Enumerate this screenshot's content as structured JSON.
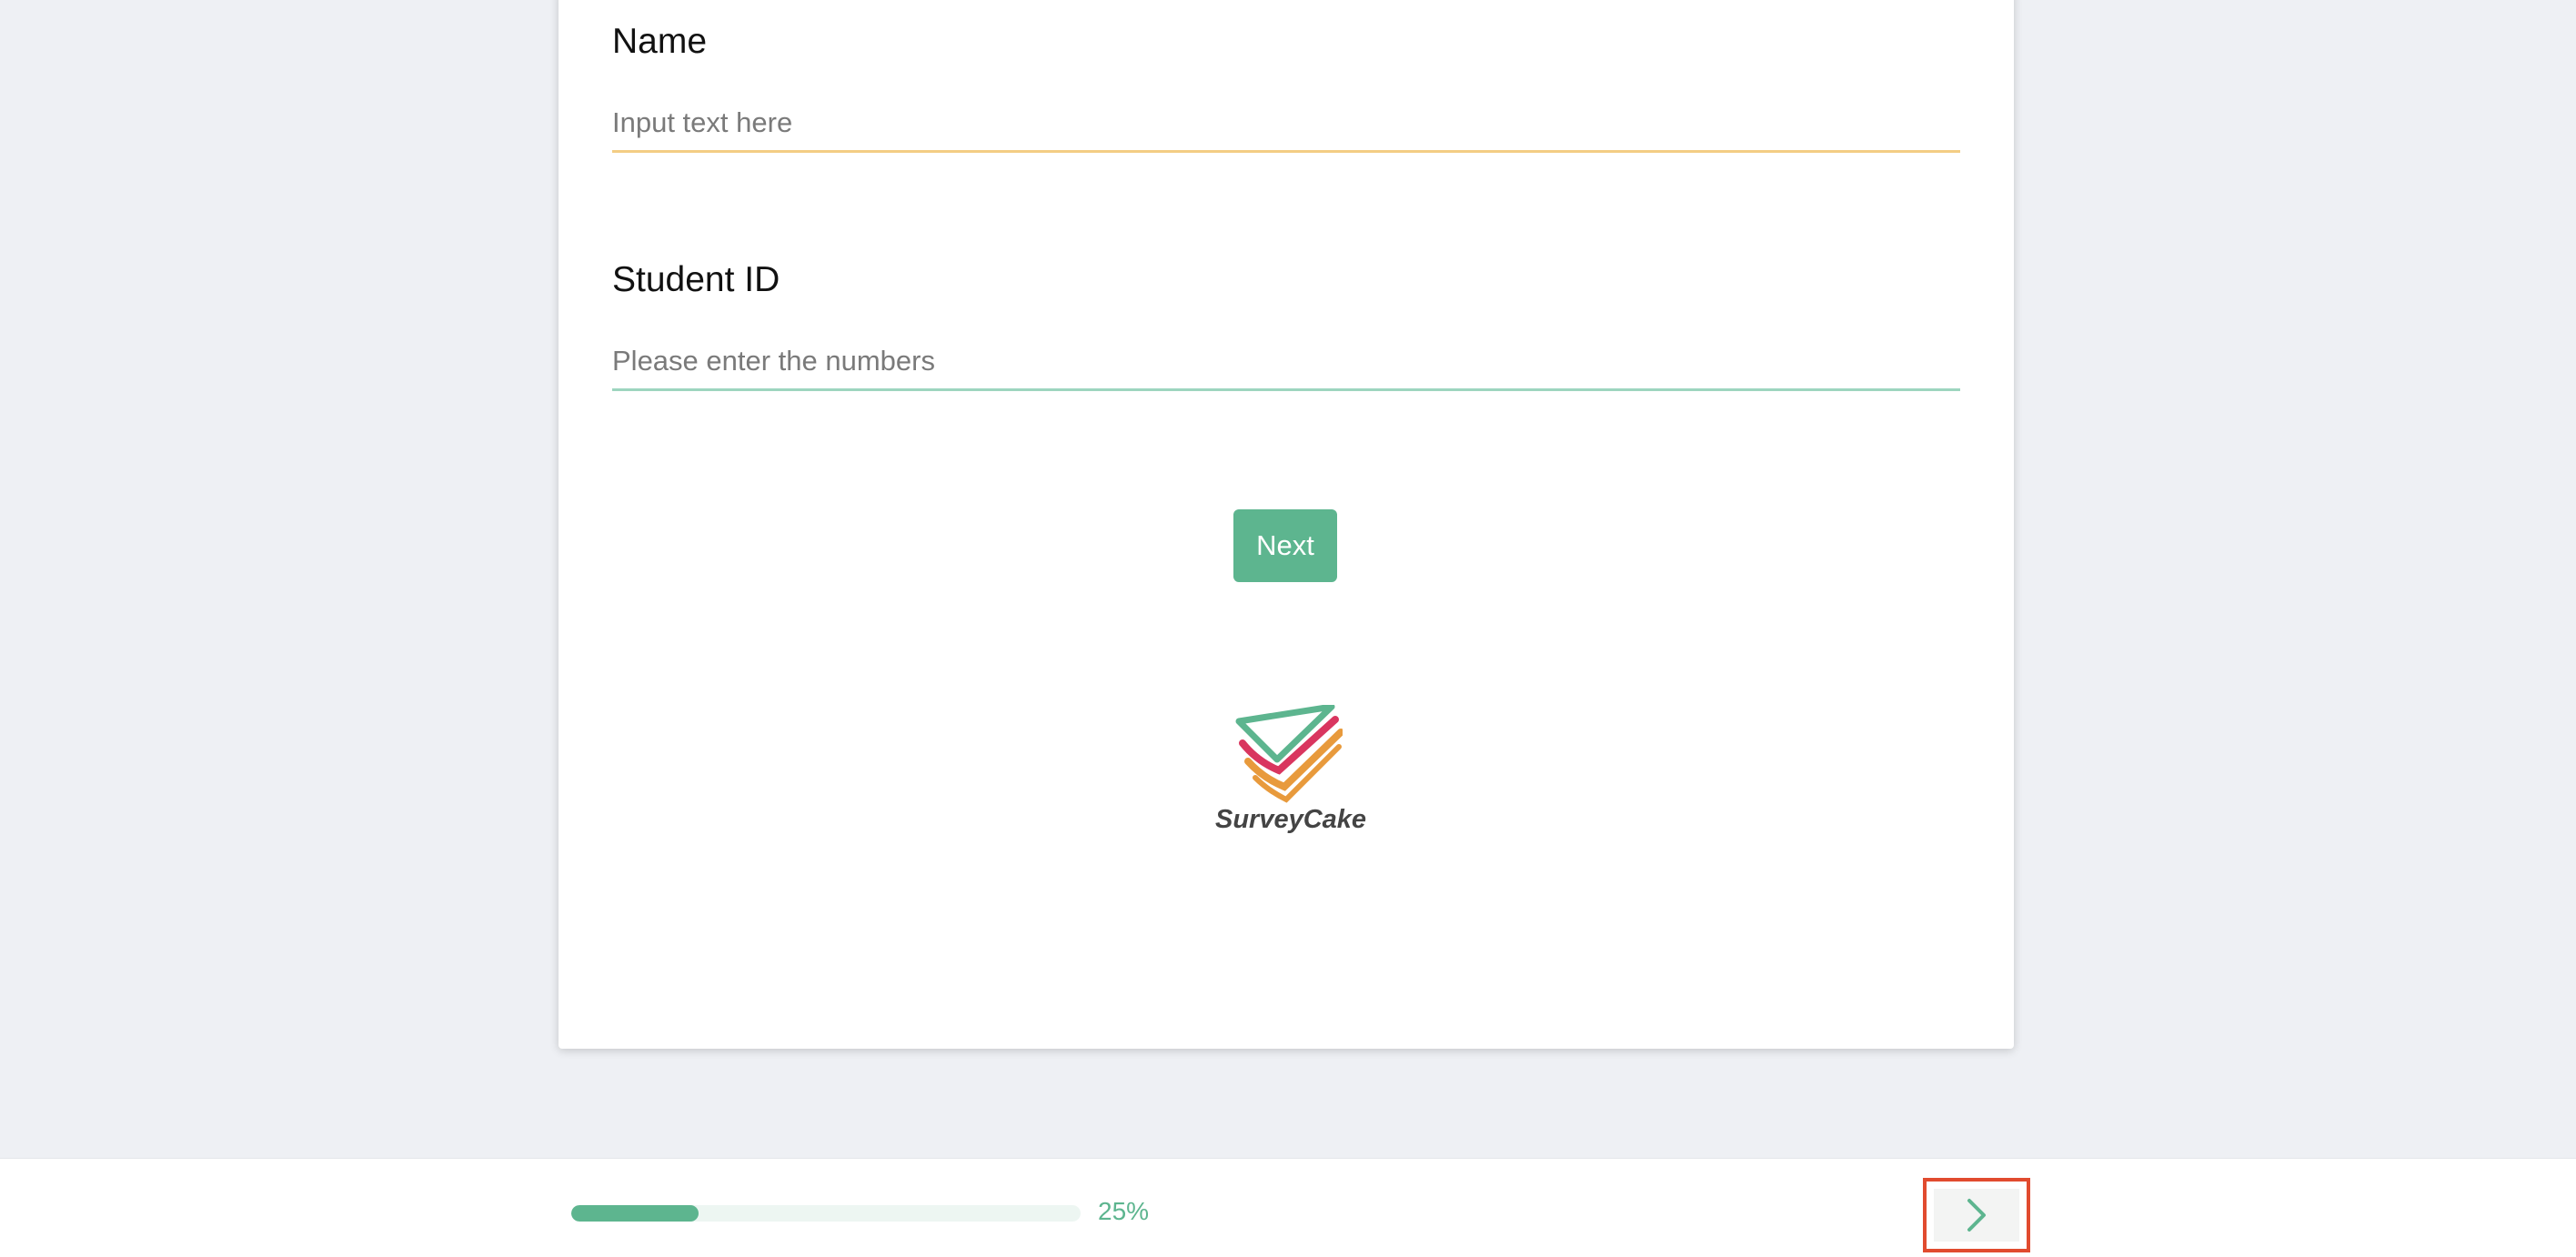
{
  "questions": {
    "name": {
      "title": "Name",
      "placeholder": "Input text here",
      "value": ""
    },
    "student_id": {
      "title": "Student ID",
      "placeholder": "Please enter the numbers",
      "value": ""
    }
  },
  "form": {
    "next_label": "Next"
  },
  "brand": {
    "logo_text": "SurveyCake",
    "logo_icon": "surveycake-check-icon",
    "colors": {
      "green": "#5db58f",
      "red": "#d9365f",
      "orange": "#e89a3c"
    }
  },
  "footer": {
    "progress_percent": 25,
    "progress_label": "25%",
    "next_page_icon": "chevron-right-icon"
  },
  "colors": {
    "accent": "#5db58f",
    "highlight_border": "#e14b2f",
    "name_underline": "#f3cd84",
    "id_underline": "#9dd5bf"
  }
}
